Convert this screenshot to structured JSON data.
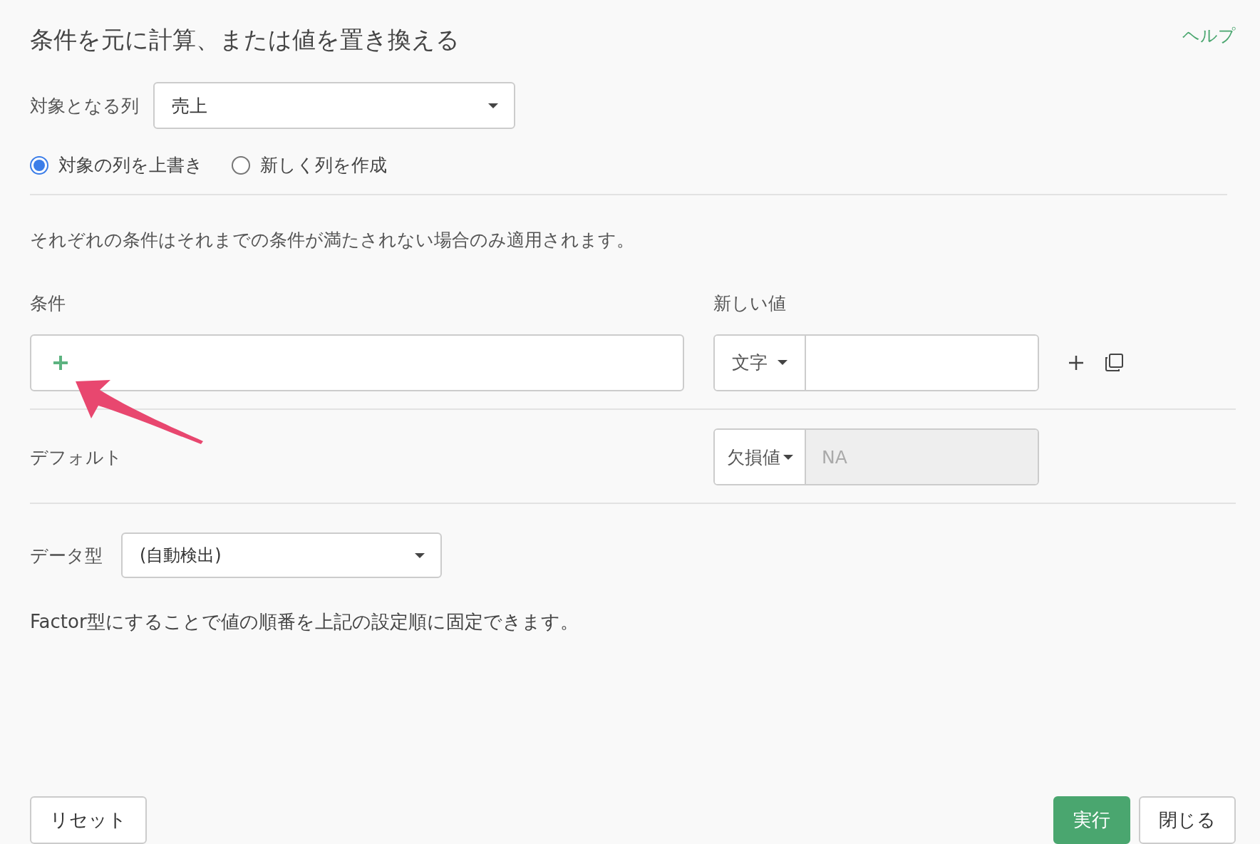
{
  "title": "条件を元に計算、または値を置き換える",
  "help_link": "ヘルプ",
  "target_column": {
    "label": "対象となる列",
    "value": "売上"
  },
  "mode_options": [
    {
      "label": "対象の列を上書き",
      "selected": true
    },
    {
      "label": "新しく列を作成",
      "selected": false
    }
  ],
  "note": "それぞれの条件はそれまでの条件が満たされない場合のみ適用されます。",
  "conditions": {
    "condition_header": "条件",
    "value_header": "新しい値",
    "rows": [
      {
        "type_label": "文字"
      }
    ]
  },
  "default": {
    "label": "デフォルト",
    "type_label": "欠損値",
    "placeholder": "NA",
    "disabled": true
  },
  "data_type": {
    "label": "データ型",
    "value": "(自動検出)"
  },
  "factor_note": "Factor型にすることで値の順番を上記の設定順に固定できます。",
  "footer": {
    "left_buttons": [
      {
        "label": "リセット",
        "kind": "default"
      }
    ],
    "right_buttons": [
      {
        "label": "実行",
        "kind": "primary"
      },
      {
        "label": "閉じる",
        "kind": "default"
      }
    ]
  }
}
